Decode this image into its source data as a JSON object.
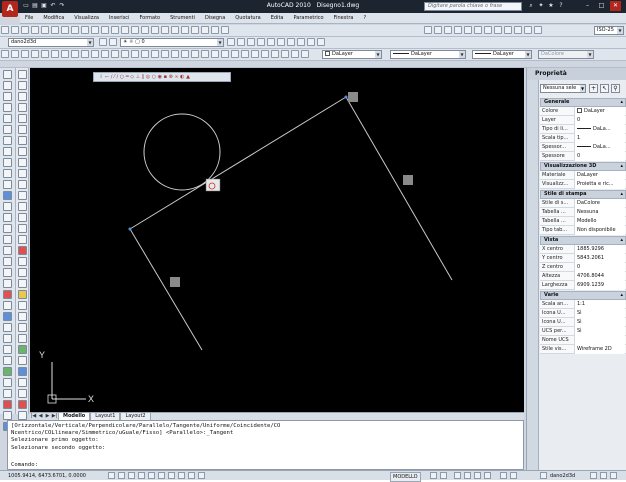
{
  "window": {
    "app_name": "AutoCAD 2010",
    "document": "Disegno1.dwg",
    "search_placeholder": "Digitare parola chiave o frase"
  },
  "menu": [
    "File",
    "Modifica",
    "Visualizza",
    "Inserisci",
    "Formato",
    "Strumenti",
    "Disegna",
    "Quotatura",
    "Edita",
    "Parametrico",
    "Finestra",
    "?"
  ],
  "toolbars": {
    "workspace": "dano2d3d",
    "dimstyle": "ISO-25",
    "layer": "0",
    "color": "DaLayer",
    "linetype": "DaLayer",
    "lineweight": "DaLayer",
    "plotstyle": "DaColore"
  },
  "canvas": {
    "ucs_x": "X",
    "ucs_y": "Y",
    "floating_toolbar": "⌐ ∕ ⁄ ∕ ○ ═ ◇ ⊥ ∥ ◎ ○ ◉ ▪ ⊗ ∞ ◐ ▲"
  },
  "layout_tabs": [
    "Modello",
    "Layout1",
    "Layout2"
  ],
  "command_lines": [
    "[Orizzontale/Verticale/Perpendicolare/Parallelo/Tangente/Uniforme/Coincidente/CO",
    "Ncentrico/COLlineare/Simmetrico/uGuale/Fisso] <Parallelo>:_Tangent",
    "Selezionare primo oggetto:",
    "Selezionare secondo oggetto:"
  ],
  "command_prompt": "Comando:",
  "status": {
    "coords": "1005.9414, 6473.6701, 0.0000",
    "model": "MODELLO",
    "workspace": "dano2d3d"
  },
  "properties": {
    "title": "Proprietà",
    "selection": "Nessuna sele",
    "sections": [
      {
        "name": "Generale",
        "rows": [
          {
            "key": "Colore",
            "value": "DaLayer"
          },
          {
            "key": "Layer",
            "value": "0"
          },
          {
            "key": "Tipo di li...",
            "value": "DaLa..."
          },
          {
            "key": "Scala tip...",
            "value": "1"
          },
          {
            "key": "Spessor...",
            "value": "DaLa..."
          },
          {
            "key": "Spessore",
            "value": "0"
          }
        ]
      },
      {
        "name": "Visualizzazione 3D",
        "rows": [
          {
            "key": "Materiale",
            "value": "DaLayer"
          },
          {
            "key": "Visualizz...",
            "value": "Proietta e ric..."
          }
        ]
      },
      {
        "name": "Stile di stampa",
        "rows": [
          {
            "key": "Stile di s...",
            "value": "DaColore"
          },
          {
            "key": "Tabella ...",
            "value": "Nessuna"
          },
          {
            "key": "Tabella ...",
            "value": "Modello"
          },
          {
            "key": "Tipo tab...",
            "value": "Non disponibile"
          }
        ]
      },
      {
        "name": "Vista",
        "rows": [
          {
            "key": "X centro",
            "value": "1885.9296"
          },
          {
            "key": "Y centro",
            "value": "5843.2061"
          },
          {
            "key": "Z centro",
            "value": "0"
          },
          {
            "key": "Altezza",
            "value": "4706.8044"
          },
          {
            "key": "Larghezza",
            "value": "6909.1239"
          }
        ]
      },
      {
        "name": "Varie",
        "rows": [
          {
            "key": "Scala an...",
            "value": "1:1"
          },
          {
            "key": "Icona U...",
            "value": "Sì"
          },
          {
            "key": "Icona U...",
            "value": "Sì"
          },
          {
            "key": "UCS per...",
            "value": "Sì"
          },
          {
            "key": "Nome UCS",
            "value": ""
          },
          {
            "key": "Stile vis...",
            "value": "Wireframe 2D"
          }
        ]
      }
    ]
  }
}
